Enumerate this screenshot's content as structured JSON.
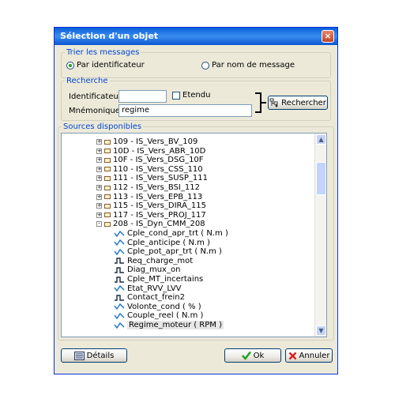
{
  "window": {
    "title": "Sélection d'un objet",
    "close_icon": "×"
  },
  "sort": {
    "legend": "Trier les messages",
    "by_id": "Par identificateur",
    "by_name": "Par nom de message",
    "selected": "by_id"
  },
  "search": {
    "legend": "Recherche",
    "id_label": "Identificateur",
    "id_value": "",
    "extended_label": "Etendu",
    "mnemonic_label": "Mnémonique",
    "mnemonic_value": "regime",
    "search_button": "Rechercher"
  },
  "sources": {
    "legend": "Sources disponibles",
    "items": [
      {
        "label": "109 - IS_Vers_BV_109",
        "type": "message",
        "expander": "+"
      },
      {
        "label": "10D - IS_Vers_ABR_10D",
        "type": "message",
        "expander": "+"
      },
      {
        "label": "10F - IS_Vers_DSG_10F",
        "type": "message",
        "expander": "+"
      },
      {
        "label": "110 - IS_Vers_CSS_110",
        "type": "message",
        "expander": "+"
      },
      {
        "label": "111 - IS_Vers_SUSP_111",
        "type": "message",
        "expander": "+"
      },
      {
        "label": "112 - IS_Vers_BSI_112",
        "type": "message",
        "expander": "+"
      },
      {
        "label": "113 - IS_Vers_EPB_113",
        "type": "message",
        "expander": "+"
      },
      {
        "label": "115 - IS_Vers_DIRA_115",
        "type": "message",
        "expander": "+"
      },
      {
        "label": "117 - IS_Vers_PROJ_117",
        "type": "message",
        "expander": "+"
      },
      {
        "label": "208 - IS_Dyn_CMM_208",
        "type": "message",
        "expander": "-"
      },
      {
        "label": "Cple_cond_apr_trt ( N.m )",
        "type": "analog"
      },
      {
        "label": "Cple_anticipe ( N.m )",
        "type": "analog"
      },
      {
        "label": "Cple_pot_apr_trt ( N.m )",
        "type": "analog"
      },
      {
        "label": "Req_charge_mot",
        "type": "digital"
      },
      {
        "label": "Diag_mux_on",
        "type": "digital"
      },
      {
        "label": "Cple_MT_incertains",
        "type": "digital"
      },
      {
        "label": "Etat_RVV_LVV",
        "type": "analog"
      },
      {
        "label": "Contact_frein2",
        "type": "digital"
      },
      {
        "label": "Volonte_cond ( % )",
        "type": "analog"
      },
      {
        "label": "Couple_reel ( N.m )",
        "type": "analog"
      },
      {
        "label": "Regime_moteur ( RPM )",
        "type": "analog",
        "selected": true
      }
    ]
  },
  "footer": {
    "details": "Détails",
    "ok": "Ok",
    "cancel": "Annuler"
  },
  "colors": {
    "title_bar": "#0a5fd8",
    "legend": "#0046d5",
    "ok_check": "#1fa01f",
    "cancel_x": "#d62020"
  }
}
